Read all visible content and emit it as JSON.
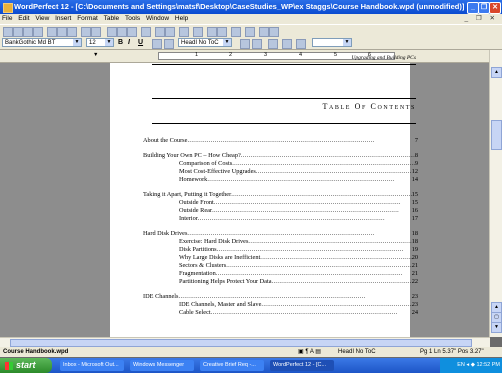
{
  "window": {
    "title": "WordPerfect 12 - [C:\\Documents and Settings\\matsf\\Desktop\\CaseStudies_WP\\ex Staggs\\Course Handbook.wpd (unmodified)]"
  },
  "menu": [
    "File",
    "Edit",
    "View",
    "Insert",
    "Format",
    "Table",
    "Tools",
    "Window",
    "Help"
  ],
  "propbar": {
    "font": "BankGothic Md BT",
    "size": "12",
    "bold": "B",
    "italic": "I",
    "underline": "U",
    "style": "HeadI No ToC"
  },
  "ruler": {
    "numbers": [
      "1",
      "2",
      "3",
      "4",
      "5",
      "6"
    ]
  },
  "document": {
    "header": "Upgrading and Building PCs",
    "toc_title": "Table Of Contents",
    "entries": [
      {
        "label": "About the Course",
        "page": "7",
        "level": 1
      },
      {
        "label": "Building Your Own PC – How Cheap?",
        "page": "8",
        "level": 1
      },
      {
        "label": "Comparison of Costs",
        "page": "9",
        "level": 2
      },
      {
        "label": "Most Cost-Effective Upgrades",
        "page": "12",
        "level": 2
      },
      {
        "label": "Homework",
        "page": "14",
        "level": 2
      },
      {
        "label": "Taking it Apart, Putting it Together",
        "page": "15",
        "level": 1
      },
      {
        "label": "Outside Front",
        "page": "15",
        "level": 2
      },
      {
        "label": "Outside Rear",
        "page": "16",
        "level": 2
      },
      {
        "label": "Interior",
        "page": "17",
        "level": 2
      },
      {
        "label": "Hard Disk Drives",
        "page": "18",
        "level": 1
      },
      {
        "label": "Exercise: Hard Disk Drives",
        "page": "18",
        "level": 2
      },
      {
        "label": "Disk Partitions",
        "page": "19",
        "level": 2
      },
      {
        "label": "Why Large Disks are Inefficient",
        "page": "20",
        "level": 2
      },
      {
        "label": "Sectors & Clusters",
        "page": "21",
        "level": 2
      },
      {
        "label": "Fragmentation",
        "page": "21",
        "level": 2
      },
      {
        "label": "Partitioning Helps Protect Your Data",
        "page": "22",
        "level": 2
      },
      {
        "label": "IDE Channels",
        "page": "23",
        "level": 1
      },
      {
        "label": "IDE Channels, Master and Slave",
        "page": "23",
        "level": 2
      },
      {
        "label": "Cable Select",
        "page": "24",
        "level": 2
      }
    ]
  },
  "status": {
    "filename": "Course Handbook.wpd",
    "style": "HeadI No ToC",
    "position": "Pg 1 Ln 5.37\" Pos 3.27\""
  },
  "taskbar": {
    "start": "start",
    "tasks": [
      "Inbox - Microsoft Out...",
      "Windows Messenger",
      "Creative Brief Req -...",
      "WordPerfect 12 - [C..."
    ],
    "clock": "12:52 PM",
    "lang": "EN"
  }
}
